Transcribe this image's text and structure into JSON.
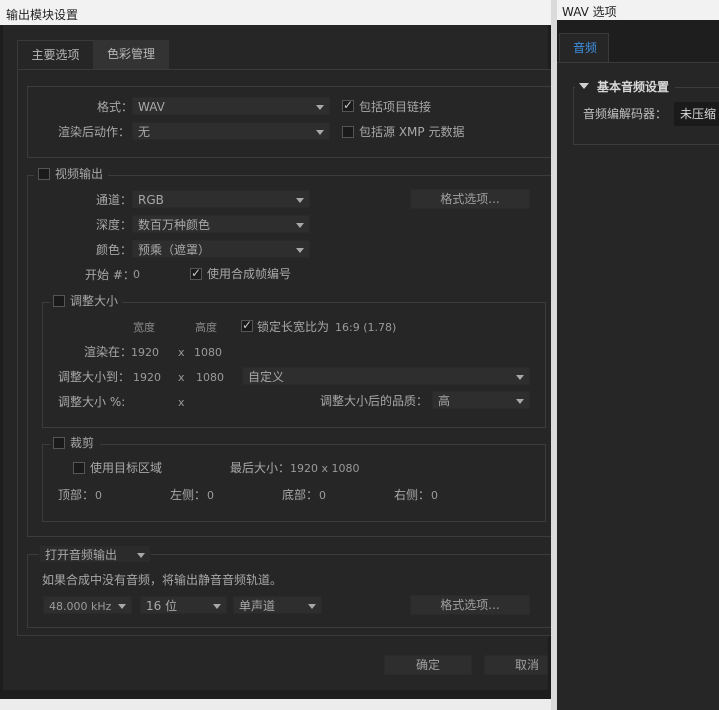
{
  "dialog": {
    "title": "输出模块设置",
    "tabs": [
      {
        "label": "主要选项"
      },
      {
        "label": "色彩管理"
      }
    ],
    "main": {
      "format_label": "格式：",
      "format_value": "WAV",
      "post_render_label": "渲染后动作：",
      "post_render_value": "无",
      "include_project_link": {
        "label": "包括项目链接",
        "checked": true
      },
      "include_xmp": {
        "label": "包括源 XMP 元数据",
        "checked": false
      }
    },
    "video": {
      "section_label": "视频输出",
      "checked": false,
      "channel_label": "通道：",
      "channel_value": "RGB",
      "depth_label": "深度：",
      "depth_value": "数百万种颜色",
      "color_label": "颜色：",
      "color_value": "预乘（遮罩）",
      "format_options_button": "格式选项...",
      "start_label": "开始 #：",
      "start_value": "0",
      "use_comp_frame": {
        "label": "使用合成帧编号",
        "checked": true
      }
    },
    "resize": {
      "section_label": "调整大小",
      "checked": false,
      "width_header": "宽度",
      "height_header": "高度",
      "lock_aspect": {
        "label": "锁定长宽比为",
        "checked": true
      },
      "aspect_value": "16:9 (1.78)",
      "render_at_label": "渲染在：",
      "render_w": "1920",
      "render_h": "1080",
      "x": "x",
      "resize_to_label": "调整大小到：",
      "resize_w": "1920",
      "resize_h": "1080",
      "preset_value": "自定义",
      "resize_pct_label": "调整大小 %:",
      "quality_label": "调整大小后的品质：",
      "quality_value": "高"
    },
    "crop": {
      "section_label": "裁剪",
      "checked": false,
      "use_roi": {
        "label": "使用目标区域",
        "checked": false
      },
      "final_size_label": "最后大小：",
      "final_size_value": "1920 x 1080",
      "top_label": "顶部：",
      "top_value": "0",
      "left_label": "左侧：",
      "left_value": "0",
      "bottom_label": "底部：",
      "bottom_value": "0",
      "right_label": "右侧：",
      "right_value": "0"
    },
    "audio": {
      "mode_value": "打开音频输出",
      "note": "如果合成中没有音频，将输出静音音频轨道。",
      "rate_value": "48.000 kHz",
      "bits_value": "16 位",
      "channels_value": "单声道",
      "format_options_button": "格式选项..."
    },
    "ok_button": "确定",
    "cancel_button": "取消"
  },
  "wav": {
    "title": "WAV 选项",
    "tab": "音频",
    "section": "基本音频设置",
    "codec_label": "音频编解码器：",
    "codec_value": "未压缩"
  },
  "colors": {
    "accent_blue": "#3d8ee0",
    "dialog_bg": "#262626",
    "titlebar": "#f2f2f2"
  }
}
